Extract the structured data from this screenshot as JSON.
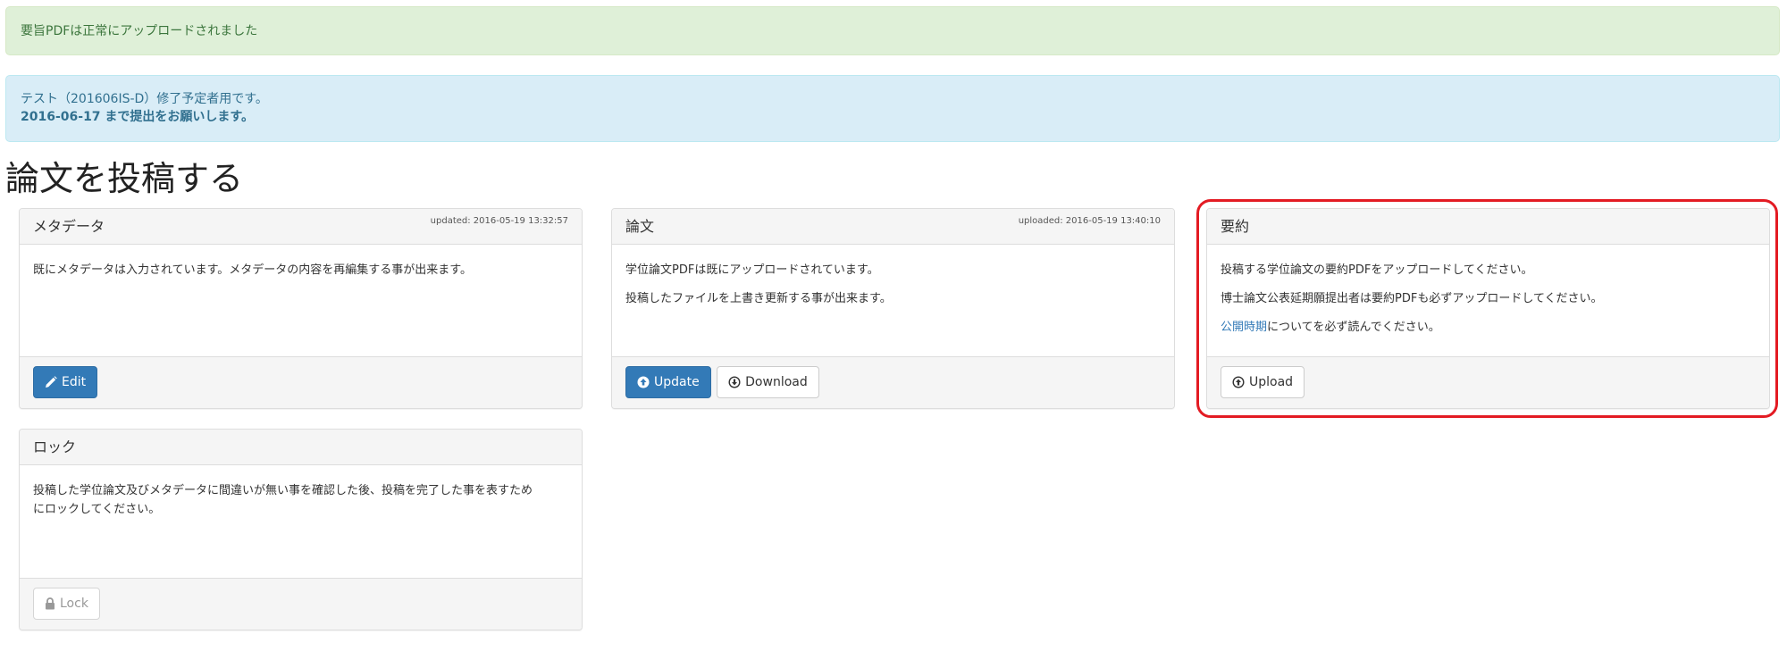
{
  "alerts": {
    "success_text": "要旨PDFは正常にアップロードされました",
    "info_line1": "テスト（201606IS-D）修了予定者用です。",
    "info_line2": "2016-06-17 まで提出をお願いします。"
  },
  "page": {
    "title": "論文を投稿する"
  },
  "panels": {
    "metadata": {
      "title": "メタデータ",
      "meta": "updated: 2016-05-19 13:32:57",
      "text1": "既にメタデータは入力されています。メタデータの内容を再編集する事が出来ます。",
      "edit_label": "Edit"
    },
    "thesis": {
      "title": "論文",
      "meta": "uploaded: 2016-05-19 13:40:10",
      "text1": "学位論文PDFは既にアップロードされています。",
      "text2": "投稿したファイルを上書き更新する事が出来ます。",
      "update_label": "Update",
      "download_label": "Download"
    },
    "summary": {
      "title": "要約",
      "text1": "投稿する学位論文の要約PDFをアップロードしてください。",
      "text2": "博士論文公表延期願提出者は要約PDFも必ずアップロードしてください。",
      "link_text": "公開時期",
      "text3_rest": "についてを必ず読んでください。",
      "upload_label": "Upload"
    },
    "lock": {
      "title": "ロック",
      "text1": "投稿した学位論文及びメタデータに間違いが無い事を確認した後、投稿を完了した事を表すため",
      "text1b": "にロックしてください。",
      "lock_label": "Lock"
    }
  },
  "icons": {
    "edit": "pencil-icon",
    "update": "circle-arrow-up-icon",
    "download": "circle-arrow-down-icon",
    "upload": "circle-arrow-up-icon",
    "lock": "lock-icon"
  },
  "colors": {
    "primary": "#337ab7",
    "highlight": "#e31b23",
    "success_bg": "#dff0d8",
    "info_bg": "#d9edf7"
  }
}
